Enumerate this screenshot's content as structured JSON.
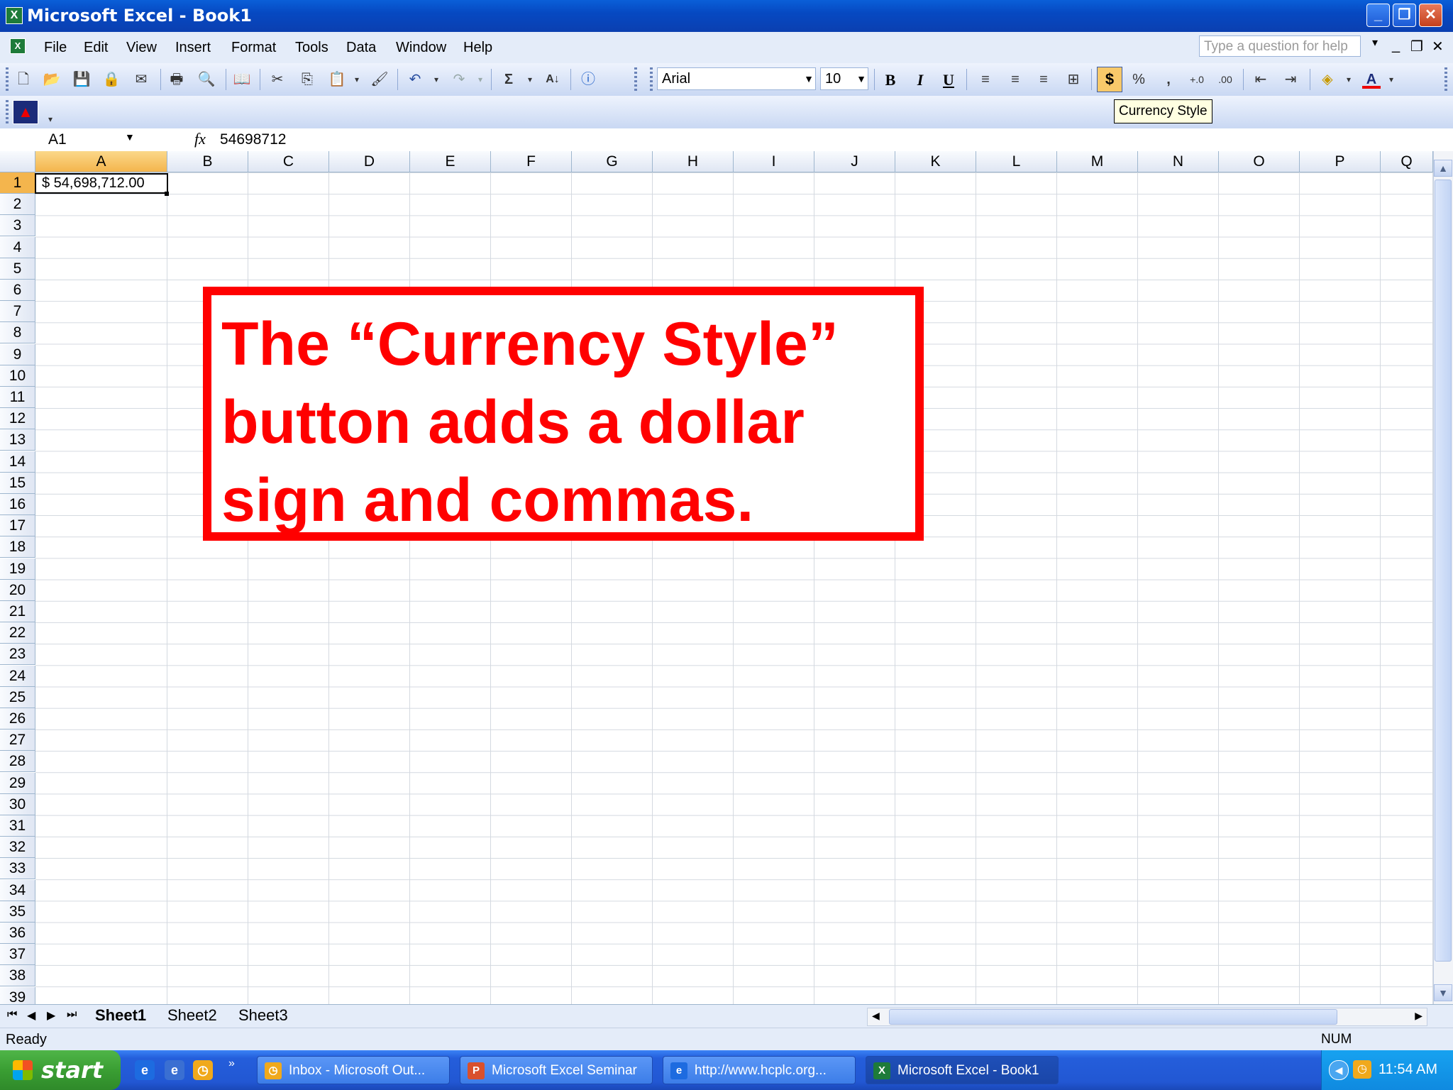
{
  "window": {
    "title": "Microsoft Excel - Book1",
    "app_icon": "excel-icon"
  },
  "menu": {
    "items": [
      "File",
      "Edit",
      "View",
      "Insert",
      "Format",
      "Tools",
      "Data",
      "Window",
      "Help"
    ],
    "help_placeholder": "Type a question for help"
  },
  "toolbar": {
    "font_name": "Arial",
    "font_size": "10",
    "bold": "B",
    "italic": "I",
    "underline": "U",
    "currency_symbol": "$",
    "percent_symbol": "%",
    "comma_symbol": ",",
    "tooltip": "Currency Style"
  },
  "formula_bar": {
    "name_box": "A1",
    "fx_label": "fx",
    "value": "54698712"
  },
  "grid": {
    "columns": [
      "A",
      "B",
      "C",
      "D",
      "E",
      "F",
      "G",
      "H",
      "I",
      "J",
      "K",
      "L",
      "M",
      "N",
      "O",
      "P",
      "Q"
    ],
    "rows": [
      "1",
      "2",
      "3",
      "4",
      "5",
      "6",
      "7",
      "8",
      "9",
      "10",
      "11",
      "12",
      "13",
      "14",
      "15",
      "16",
      "17",
      "18",
      "19",
      "20",
      "21",
      "22",
      "23",
      "24",
      "25",
      "26",
      "27",
      "28",
      "29",
      "30",
      "31",
      "32",
      "33",
      "34",
      "35",
      "36",
      "37",
      "38",
      "39"
    ],
    "selected_column": "A",
    "selected_row": "1",
    "cell_a1": "$ 54,698,712.00"
  },
  "annotation": {
    "lines": [
      "The “Currency Style”",
      "button adds a dollar",
      "sign and commas."
    ]
  },
  "sheets": {
    "tabs": [
      "Sheet1",
      "Sheet2",
      "Sheet3"
    ],
    "active": "Sheet1"
  },
  "status": {
    "text": "Ready",
    "num_indicator": "NUM"
  },
  "taskbar": {
    "start_label": "start",
    "tasks": [
      "Inbox - Microsoft Out...",
      "Microsoft Excel Seminar",
      "http://www.hcplc.org...",
      "Microsoft Excel - Book1"
    ],
    "clock": "11:54 AM"
  },
  "colors": {
    "accent": "#0a5fd8",
    "annotation_red": "#ff0000",
    "selected_header": "#f4b54d"
  }
}
